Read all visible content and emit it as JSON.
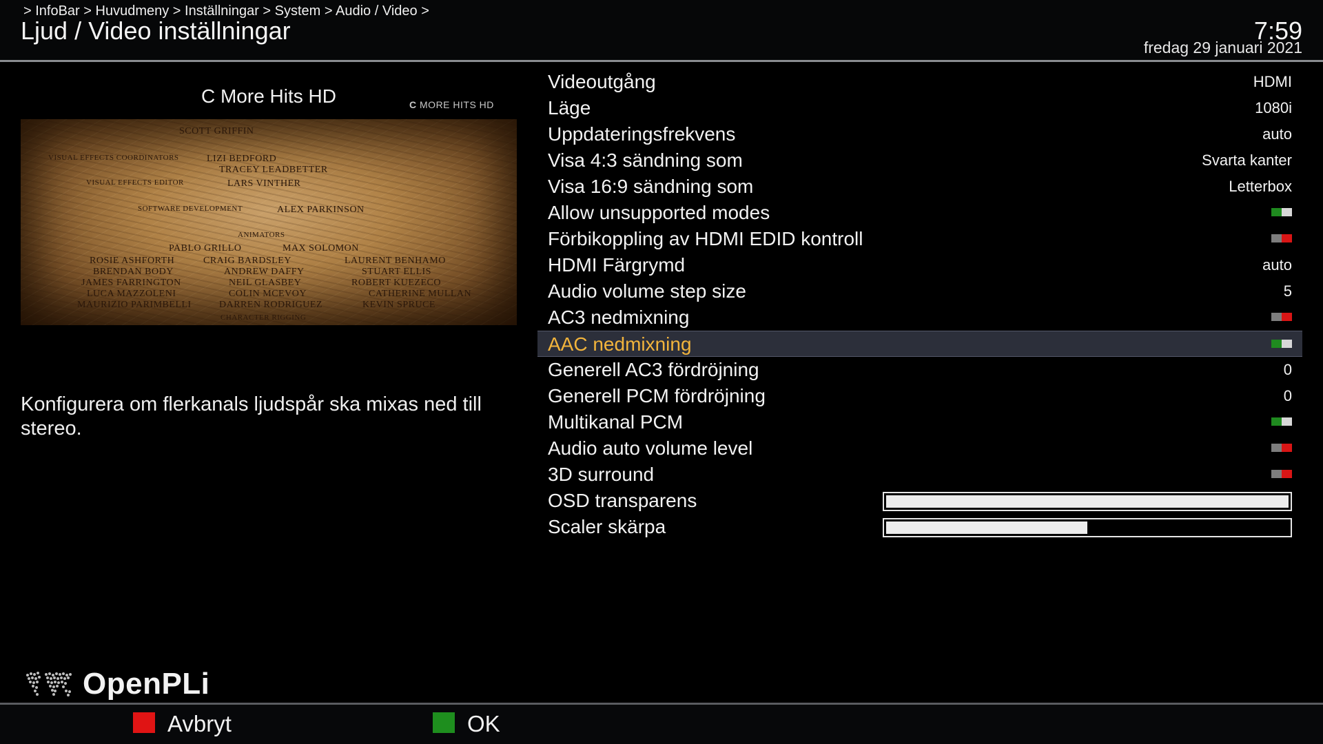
{
  "header": {
    "breadcrumb": " > InfoBar > Huvudmeny > Inställningar > System > Audio / Video >",
    "title": "Ljud / Video inställningar",
    "time": "7:59",
    "date": "fredag 29 januari 2021"
  },
  "preview": {
    "channel_name": "C More Hits HD",
    "channel_logo_c": "C",
    "channel_logo_rest": "MORE HITS HD",
    "credits": [
      {
        "text": "Scott Griffin",
        "kind": "nm"
      },
      {
        "text": "Visual Effects Coordinators",
        "kind": "role"
      },
      {
        "text": "Lizi Bedford",
        "kind": "nm"
      },
      {
        "text": "Tracey Leadbetter",
        "kind": "nm"
      },
      {
        "text": "Visual Effects Editor",
        "kind": "role"
      },
      {
        "text": "Lars Vinther",
        "kind": "nm"
      },
      {
        "text": "Software Development",
        "kind": "role"
      },
      {
        "text": "Alex Parkinson",
        "kind": "nm"
      },
      {
        "text": "Animators",
        "kind": "role"
      },
      {
        "text": "Pablo Grillo",
        "kind": "nm"
      },
      {
        "text": "Max Solomon",
        "kind": "nm"
      },
      {
        "text": "Rosie Ashforth",
        "kind": "nm"
      },
      {
        "text": "Craig Bardsley",
        "kind": "nm"
      },
      {
        "text": "Laurent Benhamo",
        "kind": "nm"
      },
      {
        "text": "Brendan Body",
        "kind": "nm"
      },
      {
        "text": "Andrew Daffy",
        "kind": "nm"
      },
      {
        "text": "Stuart Ellis",
        "kind": "nm"
      },
      {
        "text": "James Farrington",
        "kind": "nm"
      },
      {
        "text": "Neil Glasbey",
        "kind": "nm"
      },
      {
        "text": "Robert Kuezeco",
        "kind": "nm"
      },
      {
        "text": "Luca Mazzoleni",
        "kind": "nm"
      },
      {
        "text": "Colin McEvoy",
        "kind": "nm"
      },
      {
        "text": "Catherine Mullan",
        "kind": "nm"
      },
      {
        "text": "Maurizio Parimbelli",
        "kind": "nm"
      },
      {
        "text": "Darren Rodriguez",
        "kind": "nm"
      },
      {
        "text": "Kevin Spruce",
        "kind": "nm"
      },
      {
        "text": "Character Rigging",
        "kind": "role"
      }
    ]
  },
  "description": "Konfigurera om flerkanals ljudspår ska mixas ned till stereo.",
  "settings": [
    {
      "label": "Videoutgång",
      "type": "text",
      "value": "HDMI"
    },
    {
      "label": "Läge",
      "type": "text",
      "value": "1080i"
    },
    {
      "label": "Uppdateringsfrekvens",
      "type": "text",
      "value": "auto"
    },
    {
      "label": "Visa 4:3 sändning som",
      "type": "text",
      "value": "Svarta kanter"
    },
    {
      "label": "Visa 16:9 sändning som",
      "type": "text",
      "value": "Letterbox"
    },
    {
      "label": "Allow unsupported modes",
      "type": "toggle",
      "on": true
    },
    {
      "label": "Förbikoppling av HDMI EDID kontroll",
      "type": "toggle",
      "on": false
    },
    {
      "label": "HDMI Färgrymd",
      "type": "text",
      "value": "auto"
    },
    {
      "label": "Audio volume step size",
      "type": "text",
      "value": "5"
    },
    {
      "label": "AC3 nedmixning",
      "type": "toggle",
      "on": false
    },
    {
      "label": "AAC nedmixning",
      "type": "toggle",
      "on": true,
      "selected": true
    },
    {
      "label": "Generell AC3 fördröjning",
      "type": "text",
      "value": "0"
    },
    {
      "label": "Generell PCM fördröjning",
      "type": "text",
      "value": "0"
    },
    {
      "label": "Multikanal PCM",
      "type": "toggle",
      "on": true
    },
    {
      "label": "Audio auto volume level",
      "type": "toggle",
      "on": false
    },
    {
      "label": "3D surround",
      "type": "toggle",
      "on": false
    },
    {
      "label": "OSD transparens",
      "type": "slider",
      "level": 1.0
    },
    {
      "label": "Scaler skärpa",
      "type": "slider",
      "level": 0.5
    }
  ],
  "brand": {
    "name": "OpenPLi"
  },
  "footer": {
    "red_label": "Avbryt",
    "green_label": "OK"
  },
  "colors": {
    "selected_text": "#f2b43c",
    "selected_row": "#2c2f3a",
    "key_red": "#e01414",
    "key_green": "#1e8e1e",
    "toggle_on": "#1f8a1f",
    "toggle_off": "#d81515"
  },
  "icons": {
    "brand": "globe-map-icon",
    "red_key": "red-key-icon",
    "green_key": "green-key-icon",
    "toggle_on": "toggle-on-icon",
    "toggle_off": "toggle-off-icon"
  }
}
